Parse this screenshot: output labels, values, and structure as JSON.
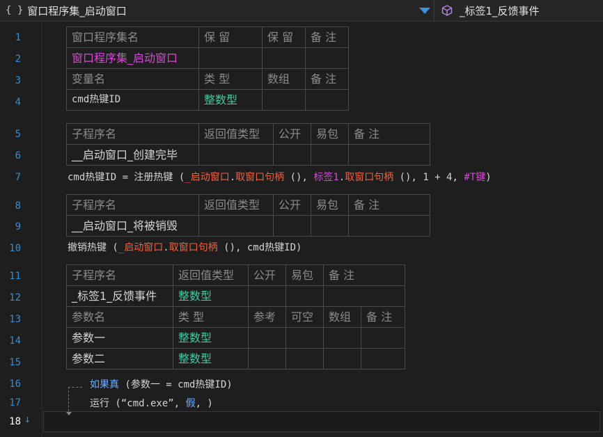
{
  "header": {
    "braces_icon": "{ }",
    "program_set_title": "窗口程序集_启动窗口",
    "subroutine_title": "_标签1_反馈事件",
    "dropdown_color": "#3d8ee0"
  },
  "editor": {
    "line_numbers": [
      "1",
      "2",
      "3",
      "4",
      "5",
      "6",
      "7",
      "8",
      "9",
      "10",
      "11",
      "12",
      "13",
      "14",
      "15",
      "16",
      "17",
      "18"
    ],
    "current_line": "18"
  },
  "program_set_table": {
    "headers": [
      "窗口程序集名",
      "保 留",
      "保 留",
      "备 注"
    ],
    "name": "窗口程序集_启动窗口",
    "var_headers": [
      "变量名",
      "类 型",
      "数组",
      "备 注"
    ],
    "var_name": "cmd热键ID",
    "var_type": "整数型"
  },
  "sub1": {
    "headers": [
      "子程序名",
      "返回值类型",
      "公开",
      "易包",
      "备 注"
    ],
    "name": "__启动窗口_创建完毕"
  },
  "line7": {
    "t1": "cmd热键ID = 注册热键 (",
    "t2": "_启动窗口",
    "t3": ".",
    "t4": "取窗口句柄",
    "t5": " (), ",
    "t6": "标签1",
    "t7": ".",
    "t8": "取窗口句柄",
    "t9": " (), 1 + 4, ",
    "t10": "#T键",
    "t11": ")"
  },
  "sub2": {
    "headers": [
      "子程序名",
      "返回值类型",
      "公开",
      "易包",
      "备 注"
    ],
    "name": "__启动窗口_将被销毁"
  },
  "line10": {
    "t1": "撤销热键 (",
    "t2": "_启动窗口",
    "t3": ".",
    "t4": "取窗口句柄",
    "t5": " (), cmd热键ID)"
  },
  "sub3": {
    "headers": [
      "子程序名",
      "返回值类型",
      "公开",
      "易包",
      "备 注"
    ],
    "name": "_标签1_反馈事件",
    "return_type": "整数型",
    "param_headers": [
      "参数名",
      "类 型",
      "参考",
      "可空",
      "数组",
      "备 注"
    ],
    "params": [
      {
        "name": "参数一",
        "type": "整数型"
      },
      {
        "name": "参数二",
        "type": "整数型"
      }
    ]
  },
  "line16": {
    "t1": "如果真",
    "t2": " (参数一 = cmd热键ID)"
  },
  "line17": {
    "t1": "运行 (“cmd.exe”, ",
    "t2": "假",
    "t3": ", )"
  },
  "colors": {
    "background": "#1e1e1e",
    "line_number": "#2f8fd6",
    "procedure_name": "#d846d8",
    "type_name": "#3ec9a4",
    "method_call": "#f0603d",
    "constant": "#e6d48c",
    "keyword": "#6bb0ff"
  }
}
